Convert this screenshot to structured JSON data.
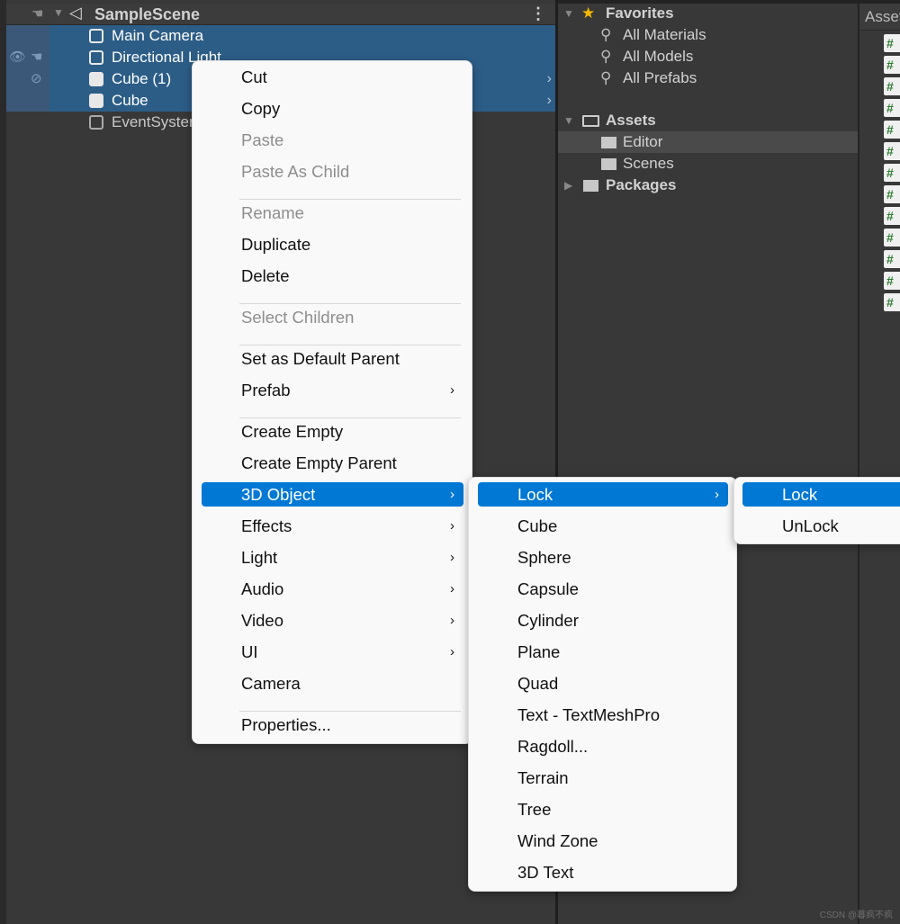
{
  "hierarchy": {
    "scene": "SampleScene",
    "items": [
      {
        "label": "Main Camera",
        "selected": true,
        "icon": "cube-outline-icon"
      },
      {
        "label": "Directional Light",
        "selected": true,
        "icon": "cube-outline-icon"
      },
      {
        "label": "Cube (1)",
        "selected": true,
        "icon": "cube-solid-icon",
        "expandable": true
      },
      {
        "label": "Cube",
        "selected": true,
        "icon": "cube-solid-icon",
        "expandable": true
      },
      {
        "label": "EventSystem",
        "selected": false,
        "icon": "cube-outline-icon"
      }
    ]
  },
  "project": {
    "favorites": "Favorites",
    "fav_items": [
      "All Materials",
      "All Models",
      "All Prefabs"
    ],
    "assets": "Assets",
    "asset_items": [
      "Editor",
      "Scenes"
    ],
    "packages": "Packages"
  },
  "right_panel": {
    "tab": "Assets",
    "file_icon": "#"
  },
  "context_menu": {
    "items": [
      {
        "label": "Cut"
      },
      {
        "label": "Copy"
      },
      {
        "label": "Paste",
        "disabled": true
      },
      {
        "label": "Paste As Child",
        "disabled": true
      },
      {
        "sep": true
      },
      {
        "label": "Rename",
        "disabled": true
      },
      {
        "label": "Duplicate"
      },
      {
        "label": "Delete"
      },
      {
        "sep": true
      },
      {
        "label": "Select Children",
        "disabled": true
      },
      {
        "sep": true
      },
      {
        "label": "Set as Default Parent"
      },
      {
        "label": "Prefab",
        "submenu": true
      },
      {
        "sep": true
      },
      {
        "label": "Create Empty"
      },
      {
        "label": "Create Empty Parent"
      },
      {
        "label": "3D Object",
        "submenu": true,
        "highlighted": true
      },
      {
        "label": "Effects",
        "submenu": true
      },
      {
        "label": "Light",
        "submenu": true
      },
      {
        "label": "Audio",
        "submenu": true
      },
      {
        "label": "Video",
        "submenu": true
      },
      {
        "label": "UI",
        "submenu": true
      },
      {
        "label": "Camera"
      },
      {
        "sep": true
      },
      {
        "label": "Properties..."
      }
    ]
  },
  "submenu_3d": {
    "items": [
      {
        "label": "Lock",
        "submenu": true,
        "highlighted": true
      },
      {
        "label": "Cube"
      },
      {
        "label": "Sphere"
      },
      {
        "label": "Capsule"
      },
      {
        "label": "Cylinder"
      },
      {
        "label": "Plane"
      },
      {
        "label": "Quad"
      },
      {
        "label": "Text - TextMeshPro"
      },
      {
        "label": "Ragdoll..."
      },
      {
        "label": "Terrain"
      },
      {
        "label": "Tree"
      },
      {
        "label": "Wind Zone"
      },
      {
        "label": "3D Text"
      }
    ]
  },
  "submenu_lock": {
    "items": [
      {
        "label": "Lock",
        "highlighted": true
      },
      {
        "label": "UnLock"
      }
    ]
  },
  "watermark": "CSDN @暮疯不疯",
  "colors": {
    "highlight": "#0078d4",
    "selection": "#2c5d87",
    "star": "#f5b800"
  }
}
